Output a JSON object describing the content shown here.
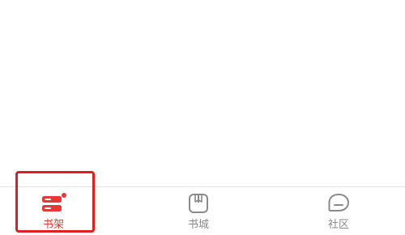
{
  "tabbar": {
    "active_color": "#e53935",
    "inactive_color": "#888888",
    "tabs": [
      {
        "label": "书架",
        "icon": "bookshelf-icon",
        "active": true
      },
      {
        "label": "书城",
        "icon": "open-book-icon",
        "active": false
      },
      {
        "label": "社区",
        "icon": "chat-bubble-icon",
        "active": false
      }
    ]
  },
  "annotation": {
    "highlight_color": "#e02020",
    "highlighted_tab": "书架"
  }
}
